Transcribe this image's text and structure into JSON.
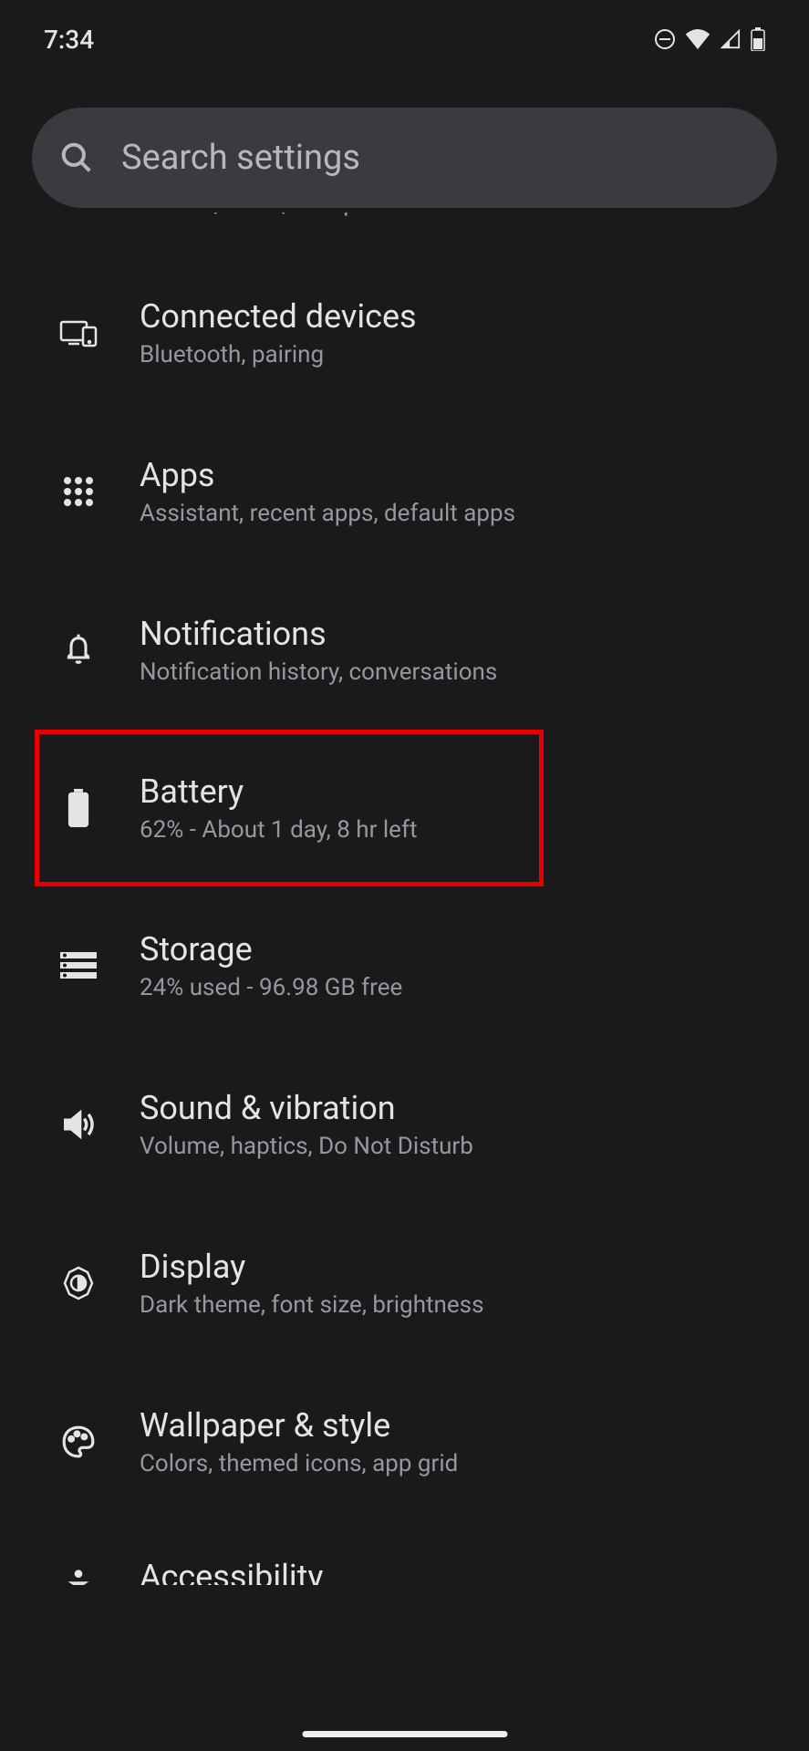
{
  "status_bar": {
    "time": "7:34"
  },
  "search": {
    "placeholder": "Search settings"
  },
  "partial_item_top": {
    "subtitle": "Mobile, Wi‑Fi, hotspot"
  },
  "items": [
    {
      "title": "Connected devices",
      "subtitle": "Bluetooth, pairing"
    },
    {
      "title": "Apps",
      "subtitle": "Assistant, recent apps, default apps"
    },
    {
      "title": "Notifications",
      "subtitle": "Notification history, conversations"
    },
    {
      "title": "Battery",
      "subtitle": "62% - About 1 day, 8 hr left"
    },
    {
      "title": "Storage",
      "subtitle": "24% used - 96.98 GB free"
    },
    {
      "title": "Sound & vibration",
      "subtitle": "Volume, haptics, Do Not Disturb"
    },
    {
      "title": "Display",
      "subtitle": "Dark theme, font size, brightness"
    },
    {
      "title": "Wallpaper & style",
      "subtitle": "Colors, themed icons, app grid"
    }
  ],
  "partial_item_bottom": {
    "title": "Accessibility"
  }
}
